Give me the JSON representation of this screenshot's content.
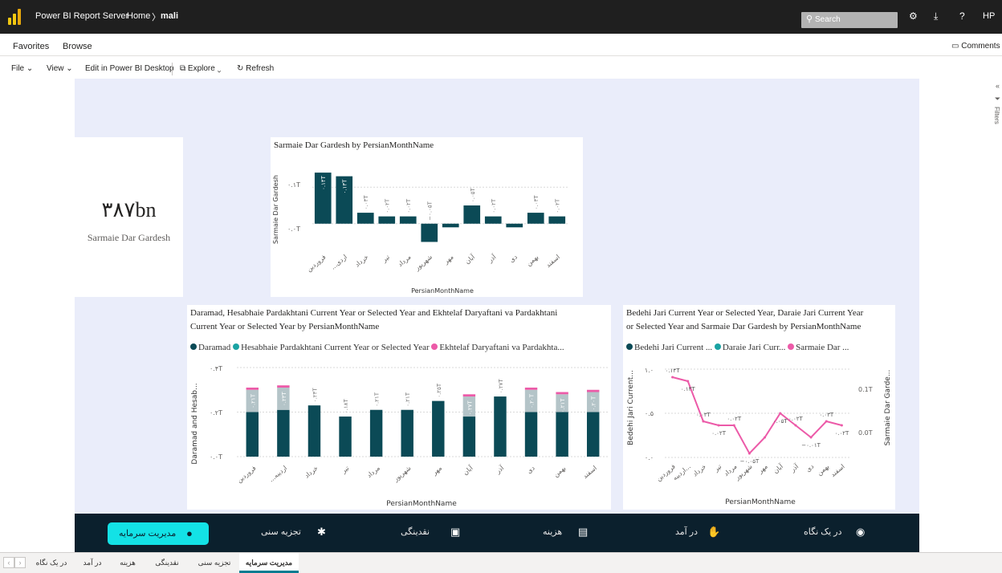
{
  "topbar": {
    "app_title": "Power BI Report Server",
    "breadcrumb_home": "Home",
    "breadcrumb_sep": "〉",
    "breadcrumb_current": "mali",
    "search_placeholder": "Search",
    "user_initials": "HP"
  },
  "menubar": {
    "favorites": "Favorites",
    "browse": "Browse",
    "comments": "Comments"
  },
  "toolbar": {
    "file": "File ⌄",
    "view": "View ⌄",
    "edit_desktop": "Edit in Power BI Desktop",
    "explore": "Explore ⌄",
    "refresh": "Refresh"
  },
  "filters_label": "Filters",
  "kpi": {
    "value": "۳۸۷bn",
    "label": "Sarmaie Dar Gardesh"
  },
  "chart1": {
    "title": "Sarmaie Dar Gardesh by PersianMonthName",
    "ylabel": "Sarmaie Dar Gardesh",
    "xlabel": "PersianMonthName",
    "yticks": [
      "۰.۱T",
      "۰.۰T"
    ]
  },
  "chart2": {
    "title_line1": "Daramad, Hesabhaie Pardakhtani Current Year or Selected Year and Ekhtelaf Daryaftani va Pardakhtani",
    "title_line2": "Current Year or Selected Year by PersianMonthName",
    "legend": [
      "Daramad",
      "Hesabhaie Pardakhtani Current Year or Selected Year",
      "Ekhtelaf Daryaftani va Pardakhta..."
    ],
    "ylabel": "Daramad and Hesab...",
    "xlabel": "PersianMonthName",
    "yticks": [
      "۰.۴T",
      "۰.۲T",
      "۰.۰T"
    ]
  },
  "chart3": {
    "title_line1": "Bedehi Jari Current Year or Selected Year, Daraie Jari Current Year",
    "title_line2": "or Selected Year and Sarmaie Dar Gardesh by PersianMonthName",
    "legend": [
      "Bedehi Jari Current ...",
      "Daraie Jari Curr...",
      "Sarmaie Dar ..."
    ],
    "ylabel_left": "Bedehi Jari Current...",
    "ylabel_right": "Sarmaie Dar Garde...",
    "xlabel": "PersianMonthName",
    "yticks_left": [
      "۱.۰",
      "۰.۵",
      "۰.۰"
    ],
    "yticks_right": [
      "0.1T",
      "0.0T"
    ]
  },
  "chart_data": [
    {
      "type": "bar",
      "title": "Sarmaie Dar Gardesh by PersianMonthName",
      "xlabel": "PersianMonthName",
      "ylabel": "Sarmaie Dar Gardesh",
      "categories": [
        "فروردین",
        "...اردی",
        "خرداد",
        "تیر",
        "مرداد",
        "شهریور",
        "مهر",
        "آبان",
        "آذر",
        "دی",
        "بهمن",
        "اسفند"
      ],
      "values": [
        0.14,
        0.13,
        0.03,
        0.02,
        0.02,
        -0.05,
        -0.01,
        0.05,
        0.02,
        -0.01,
        0.03,
        0.02
      ],
      "data_labels": [
        "۰.۱۴T",
        "۰.۱۳T",
        "۰.۰۳T",
        "۰.۰۲T",
        "۰.۰۲T",
        "−۰.۰۵T",
        "",
        "۰.۰۵T",
        "۰.۰۲T",
        "",
        "۰.۰۳T",
        "۰.۰۲T"
      ],
      "ylim": [
        -0.06,
        0.16
      ],
      "color": "#0b4a56"
    },
    {
      "type": "bar",
      "stacked": true,
      "xlabel": "PersianMonthName",
      "ylabel": "Daramad and Hesab...",
      "categories": [
        "فروردین",
        "...اردیبه",
        "خرداد",
        "تیر",
        "مرداد",
        "شهریور",
        "مهر",
        "آبان",
        "آذر",
        "دی",
        "بهمن",
        "اسفند"
      ],
      "series": [
        {
          "name": "Daramad",
          "values": [
            0.2,
            0.21,
            0.23,
            0.18,
            0.21,
            0.21,
            0.25,
            0.18,
            0.27,
            0.2,
            0.2,
            0.2
          ],
          "color": "#0b4a56"
        },
        {
          "name": "Hesabhaie Pardakhtani Current Year or Selected Year",
          "values": [
            0.1,
            0.1,
            0,
            0,
            0,
            0,
            0,
            0.09,
            0,
            0.1,
            0.08,
            0.09
          ],
          "color": "#b4c4c8"
        },
        {
          "name": "Ekhtelaf Daryaftani va Pardakhta...",
          "values": [
            0.01,
            0.01,
            0,
            0,
            0,
            0,
            0,
            0.01,
            0,
            0.01,
            0.01,
            0.01
          ],
          "color": "#ec5aa8"
        }
      ],
      "data_labels": [
        "۰.۲۱T",
        "۰.۲۳T",
        "۰.۲۳T",
        "۰.۱۸T",
        "۰.۲۱T",
        "۰.۲۱T",
        "۰.۲۵T",
        "۰.۲۷T",
        "۰.۲۷T",
        "۰.۲۰T",
        "۰.۲۱T",
        "۰.۲۰T"
      ],
      "ylim": [
        0,
        0.4
      ]
    },
    {
      "type": "line",
      "xlabel": "PersianMonthName",
      "categories": [
        "فروردین",
        "اردیبه...",
        "خرداد",
        "تیر",
        "مرداد",
        "شهریور",
        "مهر",
        "آبان",
        "آذر",
        "دی",
        "بهمن",
        "اسفند"
      ],
      "series": [
        {
          "name": "Sarmaie Dar ...",
          "values": [
            0.14,
            0.13,
            0.03,
            0.03,
            0.02,
            0.02,
            -0.05,
            -0.01,
            0.05,
            0.02,
            -0.01,
            0.03,
            0.02
          ],
          "color": "#ec5aa8"
        }
      ],
      "line_values": [
        0.14,
        0.13,
        0.03,
        0.02,
        0.02,
        -0.05,
        -0.01,
        0.05,
        0.02,
        -0.01,
        0.03,
        0.02
      ],
      "data_labels": [
        "۰.۱۴T",
        "۰.۱۳T",
        "۰.۰۳T",
        "۰.۰۲T",
        "۰.۰۲T",
        "−۰.۰۵T",
        "",
        "۰.۰۵T",
        "۰.۰۲T",
        "−۰.۰۱T",
        "۰.۰۳T",
        "۰.۰۲T"
      ],
      "ylim_left": [
        0,
        1
      ],
      "ylim_right": [
        -0.06,
        0.16
      ]
    }
  ],
  "navbar": {
    "items": [
      {
        "label": "مدیریت سرمایه",
        "icon": "piggy-bank-icon"
      },
      {
        "label": "تجزیه سنی",
        "icon": "person-icon"
      },
      {
        "label": "نقدینگی",
        "icon": "cash-icon"
      },
      {
        "label": "هزینه",
        "icon": "receipt-icon"
      },
      {
        "label": "در آمد",
        "icon": "hand-coin-icon"
      },
      {
        "label": "در یک نگاه",
        "icon": "coins-icon"
      }
    ]
  },
  "tabs": [
    "در یک نگاه",
    "در آمد",
    "هزینه",
    "نقدینگی",
    "تجزیه سنی",
    "مدیریت سرمایه"
  ],
  "colors": {
    "dark": "#0b4a56",
    "teal": "#13e2e6",
    "pink": "#ec5aa8",
    "grey": "#b4c4c8",
    "nav": "#0b202d"
  }
}
